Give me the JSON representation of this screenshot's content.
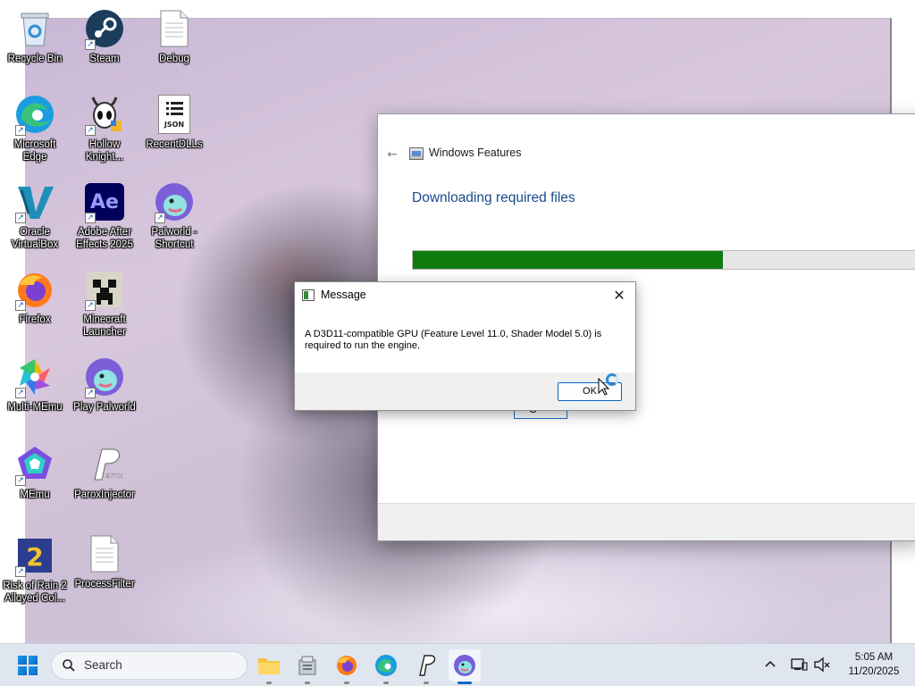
{
  "desktop": {
    "icons": [
      {
        "label": "Recycle Bin",
        "icon": "recycle-bin-icon"
      },
      {
        "label": "Steam",
        "icon": "steam-icon"
      },
      {
        "label": "Debug",
        "icon": "document-icon"
      },
      {
        "label": "Microsoft\nEdge",
        "icon": "edge-icon"
      },
      {
        "label": "Hollow\nKnight...",
        "icon": "hollow-knight-icon"
      },
      {
        "label": "RecentDLLs",
        "icon": "json-file-icon"
      },
      {
        "label": "Oracle\nVirtualBox",
        "icon": "virtualbox-icon"
      },
      {
        "label": "Adobe After\nEffects 2025",
        "icon": "after-effects-icon"
      },
      {
        "label": "Palworld -\nShortcut",
        "icon": "palworld-icon"
      },
      {
        "label": "Firefox",
        "icon": "firefox-icon"
      },
      {
        "label": "Minecraft\nLauncher",
        "icon": "minecraft-icon"
      },
      {
        "label": "Multi-MEmu",
        "icon": "multi-memu-icon"
      },
      {
        "label": "Play Palworld",
        "icon": "palworld-icon"
      },
      {
        "label": "MEmu",
        "icon": "memu-icon"
      },
      {
        "label": "ParoxInjector",
        "icon": "parox-icon"
      },
      {
        "label": "Risk of Rain 2\nAlloyed Col...",
        "icon": "risk-of-rain-icon"
      },
      {
        "label": "ProcessFilter",
        "icon": "document-icon"
      }
    ],
    "json_badge": "JSON",
    "ae_badge": "Ae"
  },
  "features_window": {
    "title": "Windows Features",
    "heading": "Downloading required files",
    "progress": 0.6,
    "button_label": "C",
    "progress_color": "#0f7b0f"
  },
  "message_dialog": {
    "title": "Message",
    "text": "A D3D11-compatible GPU (Feature Level 11.0, Shader Model 5.0) is required to run the engine.",
    "ok_label": "OK",
    "close_glyph": "✕"
  },
  "taskbar": {
    "search_placeholder": "Search",
    "apps": [
      "file-explorer-icon",
      "file-manager-icon",
      "firefox-icon",
      "edge-icon",
      "parox-icon",
      "palworld-icon"
    ],
    "active_app": "palworld-icon",
    "time": "5:05 AM",
    "date": "11/20/2025",
    "tray_chevron": "^"
  },
  "colors": {
    "accent": "#0067c0",
    "taskbar": "#dfe6ef"
  }
}
